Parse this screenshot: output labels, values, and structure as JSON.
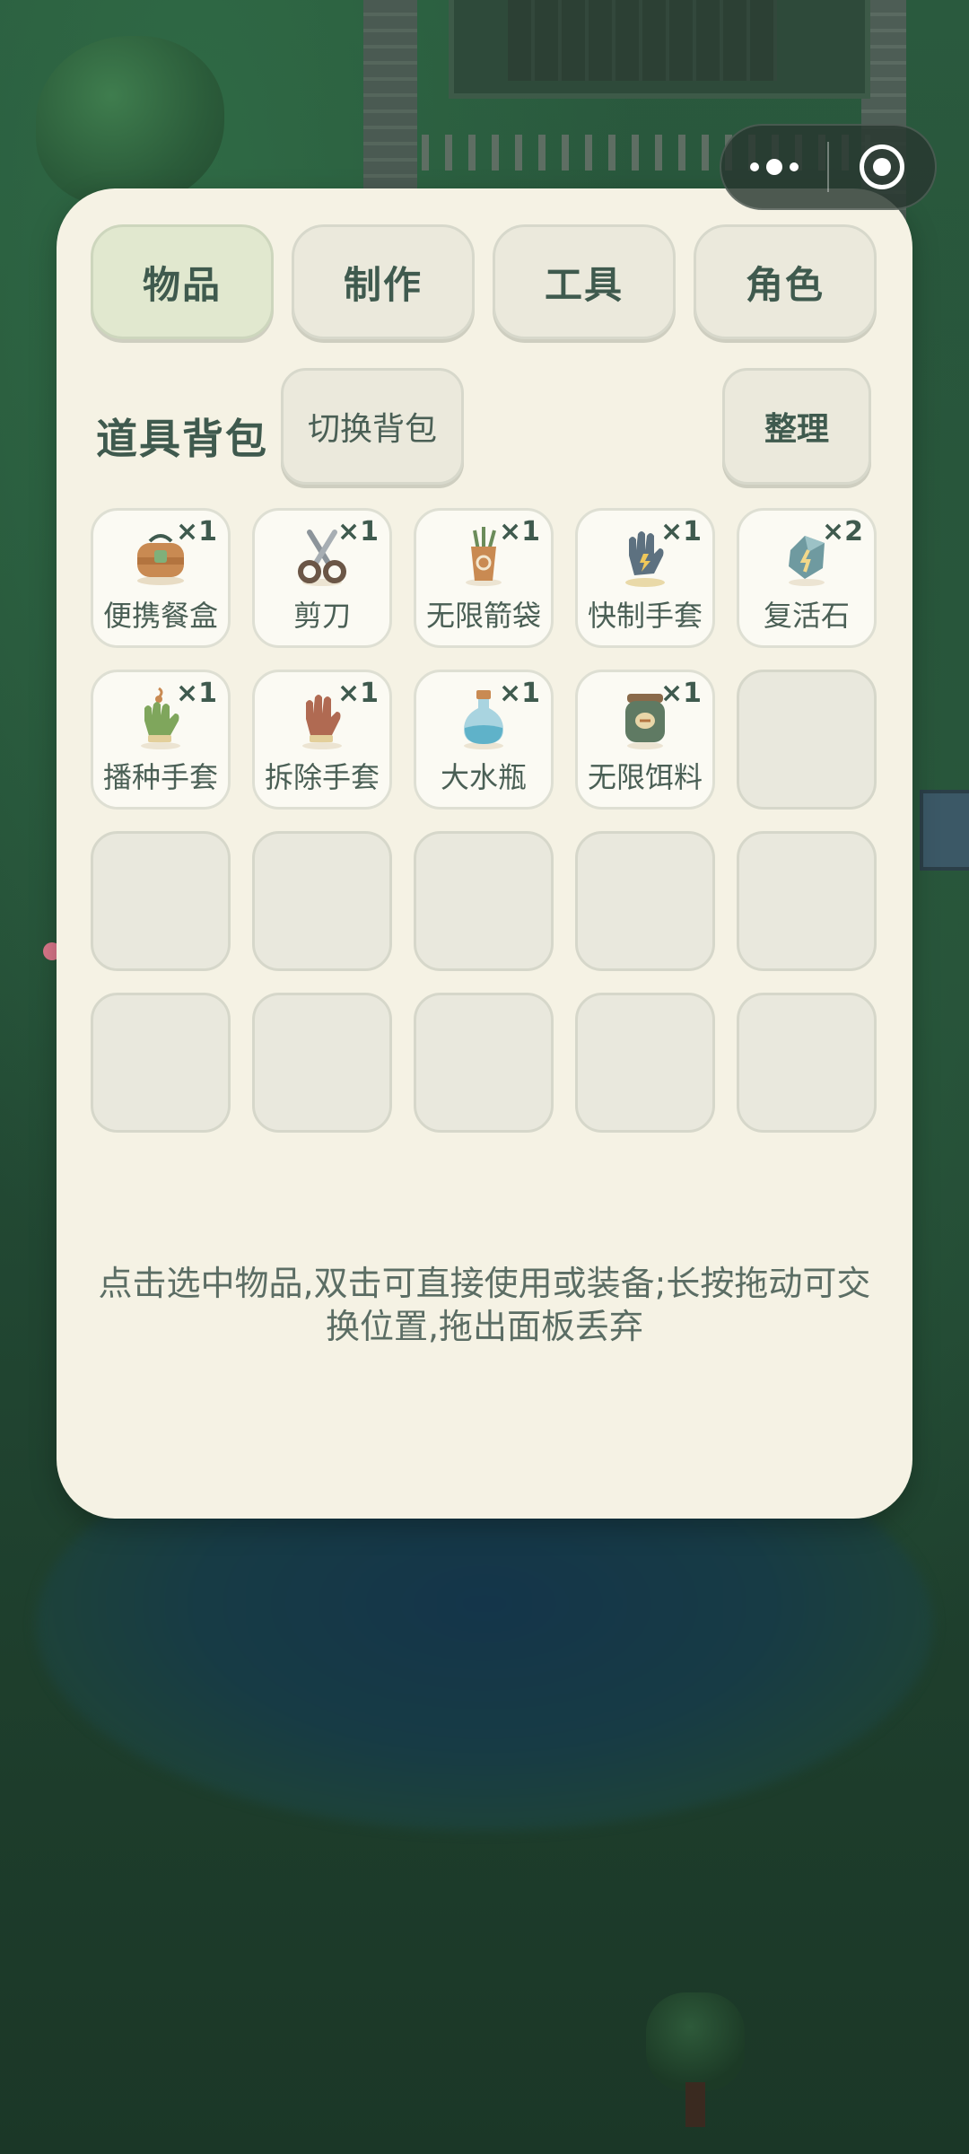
{
  "tabs": [
    {
      "label": "物品",
      "active": true
    },
    {
      "label": "制作",
      "active": false
    },
    {
      "label": "工具",
      "active": false
    },
    {
      "label": "角色",
      "active": false
    }
  ],
  "bag": {
    "title": "道具背包",
    "switch_label": "切换背包",
    "sort_label": "整理"
  },
  "items": [
    {
      "name": "便携餐盒",
      "count": "×1",
      "icon": "lunchbox-icon"
    },
    {
      "name": "剪刀",
      "count": "×1",
      "icon": "scissors-icon"
    },
    {
      "name": "无限箭袋",
      "count": "×1",
      "icon": "quiver-icon"
    },
    {
      "name": "快制手套",
      "count": "×1",
      "icon": "craft-glove-icon"
    },
    {
      "name": "复活石",
      "count": "×2",
      "icon": "revive-stone-icon"
    },
    {
      "name": "播种手套",
      "count": "×1",
      "icon": "seed-glove-icon"
    },
    {
      "name": "拆除手套",
      "count": "×1",
      "icon": "demolish-glove-icon"
    },
    {
      "name": "大水瓶",
      "count": "×1",
      "icon": "water-bottle-icon"
    },
    {
      "name": "无限饵料",
      "count": "×1",
      "icon": "bait-jar-icon"
    }
  ],
  "hint": "点击选中物品,双击可直接使用或装备;长按拖动可交换位置,拖出面板丢弃",
  "colors": {
    "panel_bg": "#f5f2e4",
    "tab_active": "#e1e8cf",
    "tab_bg": "#ebe9dc",
    "text_dark": "#3f5a4e",
    "slot_empty": "#e9e8dd"
  }
}
